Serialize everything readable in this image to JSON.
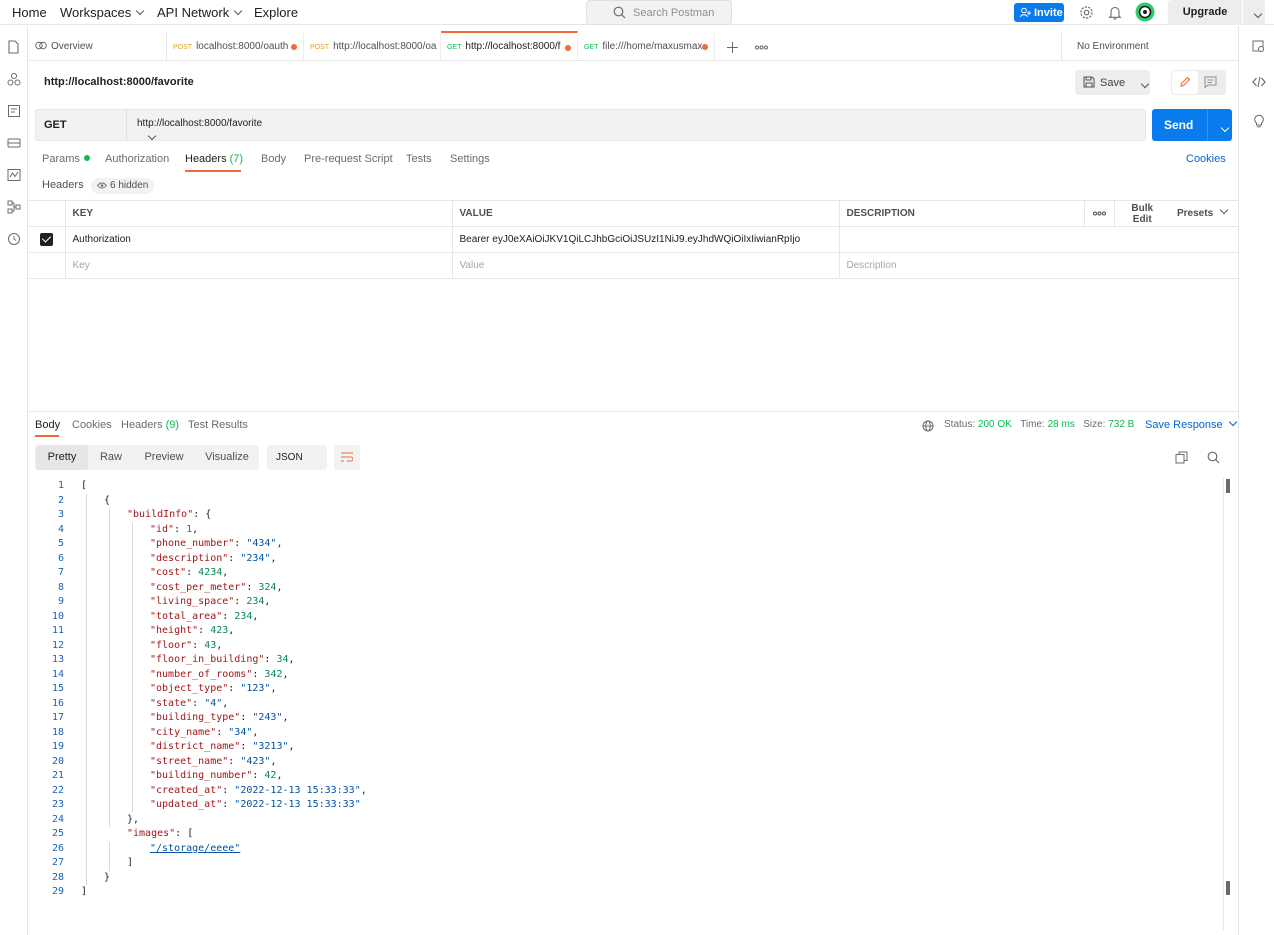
{
  "topbar": {
    "home": "Home",
    "workspaces": "Workspaces",
    "api_network": "API Network",
    "explore": "Explore",
    "search_placeholder": "Search Postman",
    "invite": "Invite",
    "upgrade": "Upgrade"
  },
  "tabs": [
    {
      "label": "Overview",
      "method": ""
    },
    {
      "label": "localhost:8000/oauth",
      "method": "POST"
    },
    {
      "label": "http://localhost:8000/oa",
      "method": "POST"
    },
    {
      "label": "http://localhost:8000/f",
      "method": "GET"
    },
    {
      "label": "file:///home/maxusmax",
      "method": "GET"
    }
  ],
  "environment": "No Environment",
  "request": {
    "title": "http://localhost:8000/favorite",
    "save_label": "Save",
    "method": "GET",
    "url": "http://localhost:8000/favorite",
    "send_label": "Send"
  },
  "req_tabs": {
    "params": "Params",
    "authorization": "Authorization",
    "headers": "Headers",
    "headers_count": "(7)",
    "body": "Body",
    "prerequest": "Pre-request Script",
    "tests": "Tests",
    "settings": "Settings",
    "cookies": "Cookies"
  },
  "headers_section": {
    "label": "Headers",
    "hidden": "6 hidden",
    "col_key": "KEY",
    "col_value": "VALUE",
    "col_description": "DESCRIPTION",
    "bulk_edit": "Bulk Edit",
    "presets": "Presets",
    "row_key": "Authorization",
    "row_value": "Bearer eyJ0eXAiOiJKV1QiLCJhbGciOiJSUzI1NiJ9.eyJhdWQiOiIxIiwianRpIjo",
    "ph_key": "Key",
    "ph_value": "Value",
    "ph_description": "Description"
  },
  "response": {
    "tab_body": "Body",
    "tab_cookies": "Cookies",
    "tab_headers": "Headers",
    "headers_count": "(9)",
    "tab_tests": "Test Results",
    "status_label": "Status:",
    "status_value": "200 OK",
    "time_label": "Time:",
    "time_value": "28 ms",
    "size_label": "Size:",
    "size_value": "732 B",
    "save_response": "Save Response",
    "view_pretty": "Pretty",
    "view_raw": "Raw",
    "view_preview": "Preview",
    "view_visualize": "Visualize",
    "format": "JSON"
  },
  "code_lines": [
    {
      "n": "1",
      "indent": 0,
      "parts": [
        [
          "p",
          "["
        ]
      ]
    },
    {
      "n": "2",
      "indent": 1,
      "parts": [
        [
          "p",
          "{"
        ]
      ]
    },
    {
      "n": "3",
      "indent": 2,
      "parts": [
        [
          "k",
          "\"buildInfo\""
        ],
        [
          "p",
          ": {"
        ]
      ]
    },
    {
      "n": "4",
      "indent": 3,
      "parts": [
        [
          "k",
          "\"id\""
        ],
        [
          "p",
          ": "
        ],
        [
          "n",
          "1"
        ],
        [
          "p",
          ","
        ]
      ]
    },
    {
      "n": "5",
      "indent": 3,
      "parts": [
        [
          "k",
          "\"phone_number\""
        ],
        [
          "p",
          ": "
        ],
        [
          "s",
          "\"434\""
        ],
        [
          "p",
          ","
        ]
      ]
    },
    {
      "n": "6",
      "indent": 3,
      "parts": [
        [
          "k",
          "\"description\""
        ],
        [
          "p",
          ": "
        ],
        [
          "s",
          "\"234\""
        ],
        [
          "p",
          ","
        ]
      ]
    },
    {
      "n": "7",
      "indent": 3,
      "parts": [
        [
          "k",
          "\"cost\""
        ],
        [
          "p",
          ": "
        ],
        [
          "n",
          "4234"
        ],
        [
          "p",
          ","
        ]
      ]
    },
    {
      "n": "8",
      "indent": 3,
      "parts": [
        [
          "k",
          "\"cost_per_meter\""
        ],
        [
          "p",
          ": "
        ],
        [
          "n",
          "324"
        ],
        [
          "p",
          ","
        ]
      ]
    },
    {
      "n": "9",
      "indent": 3,
      "parts": [
        [
          "k",
          "\"living_space\""
        ],
        [
          "p",
          ": "
        ],
        [
          "n",
          "234"
        ],
        [
          "p",
          ","
        ]
      ]
    },
    {
      "n": "10",
      "indent": 3,
      "parts": [
        [
          "k",
          "\"total_area\""
        ],
        [
          "p",
          ": "
        ],
        [
          "n",
          "234"
        ],
        [
          "p",
          ","
        ]
      ]
    },
    {
      "n": "11",
      "indent": 3,
      "parts": [
        [
          "k",
          "\"height\""
        ],
        [
          "p",
          ": "
        ],
        [
          "n",
          "423"
        ],
        [
          "p",
          ","
        ]
      ]
    },
    {
      "n": "12",
      "indent": 3,
      "parts": [
        [
          "k",
          "\"floor\""
        ],
        [
          "p",
          ": "
        ],
        [
          "n",
          "43"
        ],
        [
          "p",
          ","
        ]
      ]
    },
    {
      "n": "13",
      "indent": 3,
      "parts": [
        [
          "k",
          "\"floor_in_building\""
        ],
        [
          "p",
          ": "
        ],
        [
          "n",
          "34"
        ],
        [
          "p",
          ","
        ]
      ]
    },
    {
      "n": "14",
      "indent": 3,
      "parts": [
        [
          "k",
          "\"number_of_rooms\""
        ],
        [
          "p",
          ": "
        ],
        [
          "n",
          "342"
        ],
        [
          "p",
          ","
        ]
      ]
    },
    {
      "n": "15",
      "indent": 3,
      "parts": [
        [
          "k",
          "\"object_type\""
        ],
        [
          "p",
          ": "
        ],
        [
          "s",
          "\"123\""
        ],
        [
          "p",
          ","
        ]
      ]
    },
    {
      "n": "16",
      "indent": 3,
      "parts": [
        [
          "k",
          "\"state\""
        ],
        [
          "p",
          ": "
        ],
        [
          "s",
          "\"4\""
        ],
        [
          "p",
          ","
        ]
      ]
    },
    {
      "n": "17",
      "indent": 3,
      "parts": [
        [
          "k",
          "\"building_type\""
        ],
        [
          "p",
          ": "
        ],
        [
          "s",
          "\"243\""
        ],
        [
          "p",
          ","
        ]
      ]
    },
    {
      "n": "18",
      "indent": 3,
      "parts": [
        [
          "k",
          "\"city_name\""
        ],
        [
          "p",
          ": "
        ],
        [
          "s",
          "\"34\""
        ],
        [
          "p",
          ","
        ]
      ]
    },
    {
      "n": "19",
      "indent": 3,
      "parts": [
        [
          "k",
          "\"district_name\""
        ],
        [
          "p",
          ": "
        ],
        [
          "s",
          "\"3213\""
        ],
        [
          "p",
          ","
        ]
      ]
    },
    {
      "n": "20",
      "indent": 3,
      "parts": [
        [
          "k",
          "\"street_name\""
        ],
        [
          "p",
          ": "
        ],
        [
          "s",
          "\"423\""
        ],
        [
          "p",
          ","
        ]
      ]
    },
    {
      "n": "21",
      "indent": 3,
      "parts": [
        [
          "k",
          "\"building_number\""
        ],
        [
          "p",
          ": "
        ],
        [
          "n",
          "42"
        ],
        [
          "p",
          ","
        ]
      ]
    },
    {
      "n": "22",
      "indent": 3,
      "parts": [
        [
          "k",
          "\"created_at\""
        ],
        [
          "p",
          ": "
        ],
        [
          "s",
          "\"2022-12-13 15:33:33\""
        ],
        [
          "p",
          ","
        ]
      ]
    },
    {
      "n": "23",
      "indent": 3,
      "parts": [
        [
          "k",
          "\"updated_at\""
        ],
        [
          "p",
          ": "
        ],
        [
          "s",
          "\"2022-12-13 15:33:33\""
        ]
      ]
    },
    {
      "n": "24",
      "indent": 2,
      "parts": [
        [
          "p",
          "},"
        ]
      ]
    },
    {
      "n": "25",
      "indent": 2,
      "parts": [
        [
          "k",
          "\"images\""
        ],
        [
          "p",
          ": ["
        ]
      ]
    },
    {
      "n": "26",
      "indent": 3,
      "parts": [
        [
          "s",
          "\"/storage/eeee\""
        ]
      ]
    },
    {
      "n": "27",
      "indent": 2,
      "parts": [
        [
          "p",
          "]"
        ]
      ]
    },
    {
      "n": "28",
      "indent": 1,
      "parts": [
        [
          "p",
          "}"
        ]
      ]
    },
    {
      "n": "29",
      "indent": 0,
      "parts": [
        [
          "p",
          "]"
        ]
      ]
    }
  ]
}
